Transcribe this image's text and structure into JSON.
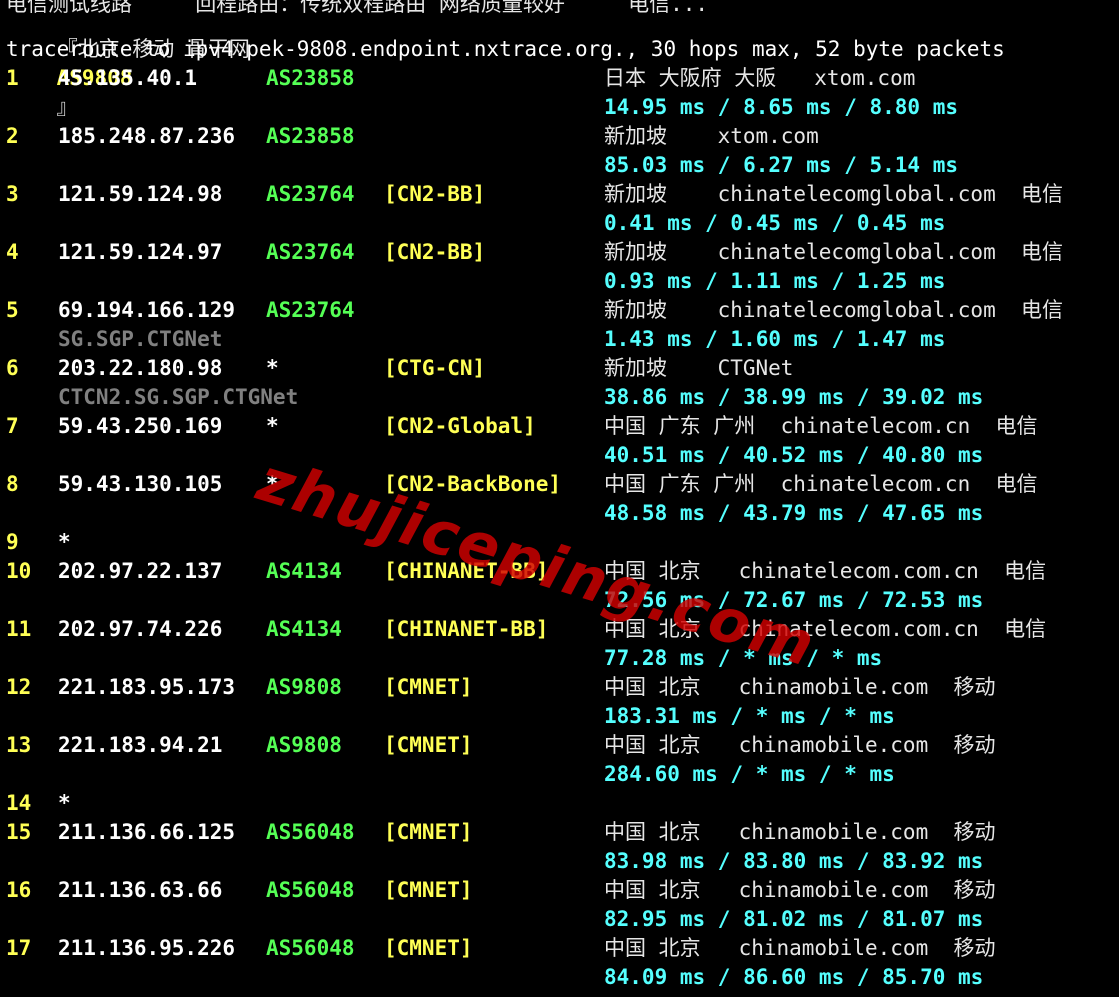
{
  "top_cut_text": "电信测试线路     回程路由：传统双程路由 网络质量较好     电信...",
  "header": {
    "title": "『北京 移动 骨干网",
    "as": "AS9808",
    "suffix": "』",
    "command": "traceroute to ipv4.pek-9808.endpoint.nxtrace.org., 30 hops max, 52 byte packets"
  },
  "hops": [
    {
      "n": "1",
      "ip": "45.135.40.1",
      "asn": "AS23858",
      "tag": "",
      "geo": "日本 大阪府 大阪   xtom.com",
      "rtt": "14.95 ms / 8.65 ms / 8.80 ms",
      "rdns": ""
    },
    {
      "n": "2",
      "ip": "185.248.87.236",
      "asn": "AS23858",
      "tag": "",
      "geo": "新加坡    xtom.com",
      "rtt": "85.03 ms / 6.27 ms / 5.14 ms",
      "rdns": ""
    },
    {
      "n": "3",
      "ip": "121.59.124.98",
      "asn": "AS23764",
      "tag": "[CN2-BB]",
      "geo": "新加坡    chinatelecomglobal.com  电信",
      "rtt": "0.41 ms / 0.45 ms / 0.45 ms",
      "rdns": ""
    },
    {
      "n": "4",
      "ip": "121.59.124.97",
      "asn": "AS23764",
      "tag": "[CN2-BB]",
      "geo": "新加坡    chinatelecomglobal.com  电信",
      "rtt": "0.93 ms / 1.11 ms / 1.25 ms",
      "rdns": ""
    },
    {
      "n": "5",
      "ip": "69.194.166.129",
      "asn": "AS23764",
      "tag": "",
      "geo": "新加坡    chinatelecomglobal.com  电信",
      "rtt": "1.43 ms / 1.60 ms / 1.47 ms",
      "rdns": "SG.SGP.CTGNet"
    },
    {
      "n": "6",
      "ip": "203.22.180.98",
      "asn": "*",
      "tag": "[CTG-CN]",
      "geo": "新加坡    CTGNet",
      "rtt": "38.86 ms / 38.99 ms / 39.02 ms",
      "rdns": "CTCN2.SG.SGP.CTGNet"
    },
    {
      "n": "7",
      "ip": "59.43.250.169",
      "asn": "*",
      "tag": "[CN2-Global]",
      "geo": "中国 广东 广州  chinatelecom.cn  电信",
      "rtt": "40.51 ms / 40.52 ms / 40.80 ms",
      "rdns": ""
    },
    {
      "n": "8",
      "ip": "59.43.130.105",
      "asn": "*",
      "tag": "[CN2-BackBone]",
      "geo": "中国 广东 广州  chinatelecom.cn  电信",
      "rtt": "48.58 ms / 43.79 ms / 47.65 ms",
      "rdns": ""
    },
    {
      "n": "9",
      "ip": "*",
      "asn": "",
      "tag": "",
      "geo": "",
      "rtt": "",
      "rdns": ""
    },
    {
      "n": "10",
      "ip": "202.97.22.137",
      "asn": "AS4134",
      "tag": "[CHINANET-BB]",
      "geo": "中国 北京   chinatelecom.com.cn  电信",
      "rtt": "72.56 ms / 72.67 ms / 72.53 ms",
      "rdns": ""
    },
    {
      "n": "11",
      "ip": "202.97.74.226",
      "asn": "AS4134",
      "tag": "[CHINANET-BB]",
      "geo": "中国 北京   chinatelecom.com.cn  电信",
      "rtt": "77.28 ms / * ms / * ms",
      "rdns": ""
    },
    {
      "n": "12",
      "ip": "221.183.95.173",
      "asn": "AS9808",
      "tag": "[CMNET]",
      "geo": "中国 北京   chinamobile.com  移动",
      "rtt": "183.31 ms / * ms / * ms",
      "rdns": ""
    },
    {
      "n": "13",
      "ip": "221.183.94.21",
      "asn": "AS9808",
      "tag": "[CMNET]",
      "geo": "中国 北京   chinamobile.com  移动",
      "rtt": "284.60 ms / * ms / * ms",
      "rdns": ""
    },
    {
      "n": "14",
      "ip": "*",
      "asn": "",
      "tag": "",
      "geo": "",
      "rtt": "",
      "rdns": ""
    },
    {
      "n": "15",
      "ip": "211.136.66.125",
      "asn": "AS56048",
      "tag": "[CMNET]",
      "geo": "中国 北京   chinamobile.com  移动",
      "rtt": "83.98 ms / 83.80 ms / 83.92 ms",
      "rdns": ""
    },
    {
      "n": "16",
      "ip": "211.136.63.66",
      "asn": "AS56048",
      "tag": "[CMNET]",
      "geo": "中国 北京   chinamobile.com  移动",
      "rtt": "82.95 ms / 81.02 ms / 81.07 ms",
      "rdns": ""
    },
    {
      "n": "17",
      "ip": "211.136.95.226",
      "asn": "AS56048",
      "tag": "[CMNET]",
      "geo": "中国 北京   chinamobile.com  移动",
      "rtt": "84.09 ms / 86.60 ms / 85.70 ms",
      "rdns": ""
    }
  ],
  "watermark": "zhujiceping.com",
  "colors": {
    "background": "#000000",
    "hop_number": "#ffff55",
    "ip": "#ffffff",
    "asn": "#55ff55",
    "tag": "#ffff55",
    "geo": "#e6e6e6",
    "rtt": "#55ffff",
    "rdns": "#808080",
    "watermark": "#d20000"
  }
}
